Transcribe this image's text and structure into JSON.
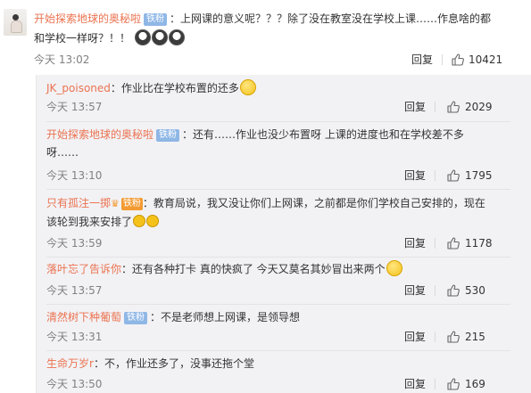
{
  "main_comment": {
    "username": "开始探索地球的奥秘啦",
    "badge": "铁粉",
    "text_line1": "：上网课的意义呢？？？除了没在教室没在学校上课……作息啥的都",
    "text_line2": "和学校一样呀？！！",
    "time": "今天 13:02",
    "reply_label": "回复",
    "likes": "10421"
  },
  "replies": [
    {
      "username": "JK_poisoned",
      "text": "：作业比在学校布置的还多",
      "time": "今天 13:57",
      "reply_label": "回复",
      "likes": "2029"
    },
    {
      "username": "开始探索地球的奥秘啦",
      "badge": "铁粉",
      "text_line1": "：还有……作业也没少布置呀 上课的进度也和在学校差不多",
      "text_line2": "呀……",
      "time": "今天 13:10",
      "reply_label": "回复",
      "likes": "1795"
    },
    {
      "username": "只有孤注一掷",
      "badge": "铁粉",
      "text_line1": "：教育局说，我又没让你们上网课，之前都是你们学校自己安排的，现在",
      "text_line2": "该轮到我来安排了",
      "time": "今天 13:59",
      "reply_label": "回复",
      "likes": "1178"
    },
    {
      "username": "落叶忘了告诉你",
      "text": "：还有各种打卡 真的快疯了 今天又莫名其妙冒出来两个",
      "time": "今天 13:57",
      "reply_label": "回复",
      "likes": "530"
    },
    {
      "username": "清然树下种葡萄",
      "badge": "铁粉",
      "text": "：不是老师想上网课，是领导想",
      "time": "今天 13:31",
      "reply_label": "回复",
      "likes": "215"
    },
    {
      "username": "生命万岁r",
      "text": "：不，作业还多了，没事还拖个堂",
      "time": "今天 13:50",
      "reply_label": "回复",
      "likes": "169"
    }
  ],
  "colors": {
    "username": "#eb7350",
    "badge": "#8fb7e6",
    "reply_bg": "#f2f2f5"
  }
}
